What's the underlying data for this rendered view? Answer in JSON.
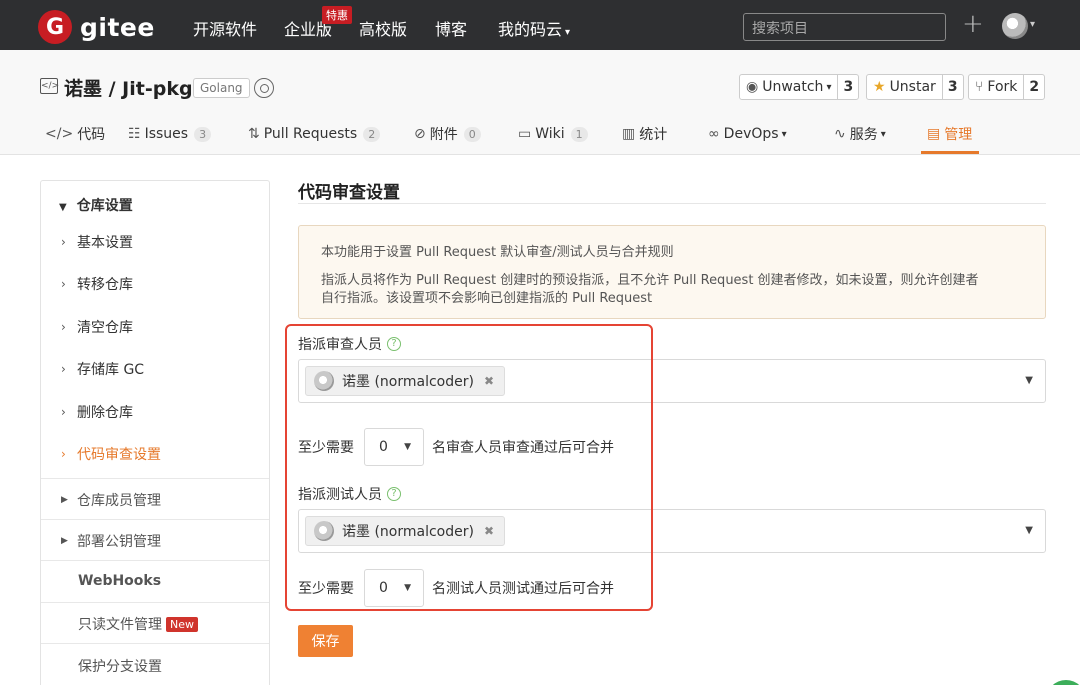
{
  "nav": {
    "logo_letter": "G",
    "logo_text": "gitee",
    "items": [
      "开源软件",
      "企业版",
      "高校版",
      "博客",
      "我的码云"
    ],
    "hot_badge": "特惠",
    "search_placeholder": "搜索项目"
  },
  "repo": {
    "title": "诺墨 / Jit-pkg",
    "language": "Golang",
    "watch": {
      "label": "Unwatch",
      "count": "3"
    },
    "star": {
      "label": "Unstar",
      "count": "3"
    },
    "fork": {
      "label": "Fork",
      "count": "2"
    }
  },
  "tabs": [
    {
      "label": "代码",
      "icon": "code-icon"
    },
    {
      "label": "Issues",
      "count": "3",
      "icon": "issues-icon"
    },
    {
      "label": "Pull Requests",
      "count": "2",
      "icon": "pull-request-icon"
    },
    {
      "label": "附件",
      "count": "0",
      "icon": "attachment-icon"
    },
    {
      "label": "Wiki",
      "count": "1",
      "icon": "wiki-icon"
    },
    {
      "label": "统计",
      "icon": "stats-icon"
    },
    {
      "label": "DevOps",
      "icon": "devops-icon"
    },
    {
      "label": "服务",
      "icon": "service-icon"
    },
    {
      "label": "管理",
      "icon": "manage-icon",
      "active": true
    }
  ],
  "sidebar": {
    "heading": "仓库设置",
    "items": [
      "基本设置",
      "转移仓库",
      "清空仓库",
      "存储库 GC",
      "删除仓库",
      "代码审查设置"
    ],
    "groups": [
      "仓库成员管理",
      "部署公钥管理"
    ],
    "plain": [
      "WebHooks",
      "只读文件管理",
      "保护分支设置"
    ],
    "new_badge": "New"
  },
  "main": {
    "title": "代码审查设置",
    "notice_line1": "本功能用于设置 Pull Request 默认审查/测试人员与合并规则",
    "notice_line2": "指派人员将作为 Pull Request 创建时的预设指派，且不允许 Pull Request 创建者修改，如未设置，则允许创建者",
    "notice_line3": "自行指派。该设置项不会影响已创建指派的 Pull Request",
    "reviewer_label": "指派审查人员",
    "reviewer_chip": "诺墨 (normalcoder)",
    "review_prefix": "至少需要",
    "review_count": "0",
    "review_suffix": "名审查人员审查通过后可合并",
    "tester_label": "指派测试人员",
    "tester_chip": "诺墨 (normalcoder)",
    "test_prefix": "至少需要",
    "test_count": "0",
    "test_suffix": "名测试人员测试通过后可合并",
    "save_label": "保存"
  },
  "colors": {
    "accent": "#e6792b",
    "nav_bg": "#2e2f31",
    "brand_red": "#c71d23",
    "highlight": "#e54434"
  }
}
